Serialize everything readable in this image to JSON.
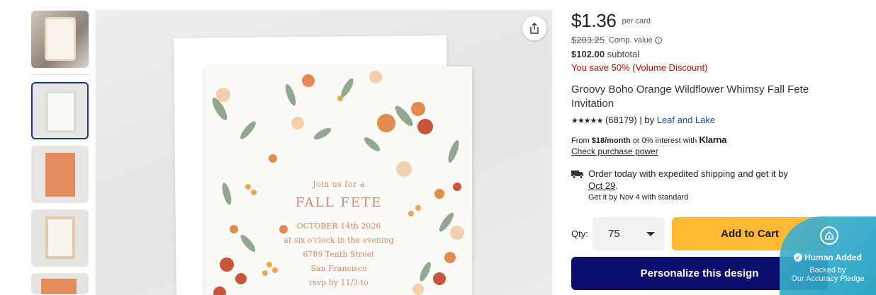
{
  "product": {
    "price": "$1.36",
    "per_card": "per card",
    "comp_price": "$203.25",
    "comp_label": "Comp. value",
    "subtotal_price": "$102.00",
    "subtotal_label": "subtotal",
    "save_text": "You save 50% (Volume Discount)",
    "title": "Groovy Boho Orange Wildflower Whimsy Fall Fete Invitation",
    "stars": "★★★★★",
    "review_count": "(68179)",
    "by_text": "| by",
    "seller": "Leaf and Lake"
  },
  "financing": {
    "prefix": "From",
    "amount": "$18/month",
    "middle": "or 0% interest with",
    "provider": "Klarna",
    "check_link": "Check purchase power"
  },
  "shipping": {
    "text": "Order today with expedited shipping and get it by",
    "date": "Oct 29",
    "period": ".",
    "standard": "Get it by Nov 4 with standard"
  },
  "purchase": {
    "qty_label": "Qty:",
    "qty_value": "75",
    "add_to_cart": "Add to Cart",
    "personalize": "Personalize this design"
  },
  "badge": {
    "title": "Human Added",
    "line1": "Backed by",
    "line2": "Our Accuracy Pledge"
  },
  "invitation": {
    "join": "Join us for a",
    "title": "FALL FETE",
    "lines": [
      "OCTOBER 14th 2026",
      "at six o'clock in the evening",
      "6789 Tenth Street",
      "San Francisco",
      "rsvp by 11/3 to"
    ]
  },
  "colors": {
    "accent_navy": "#0b0f6b",
    "cart_yellow": "#ffb933",
    "discount_red": "#d10000",
    "link_blue": "#1a4fa0",
    "badge_teal": "#2da8c7"
  }
}
